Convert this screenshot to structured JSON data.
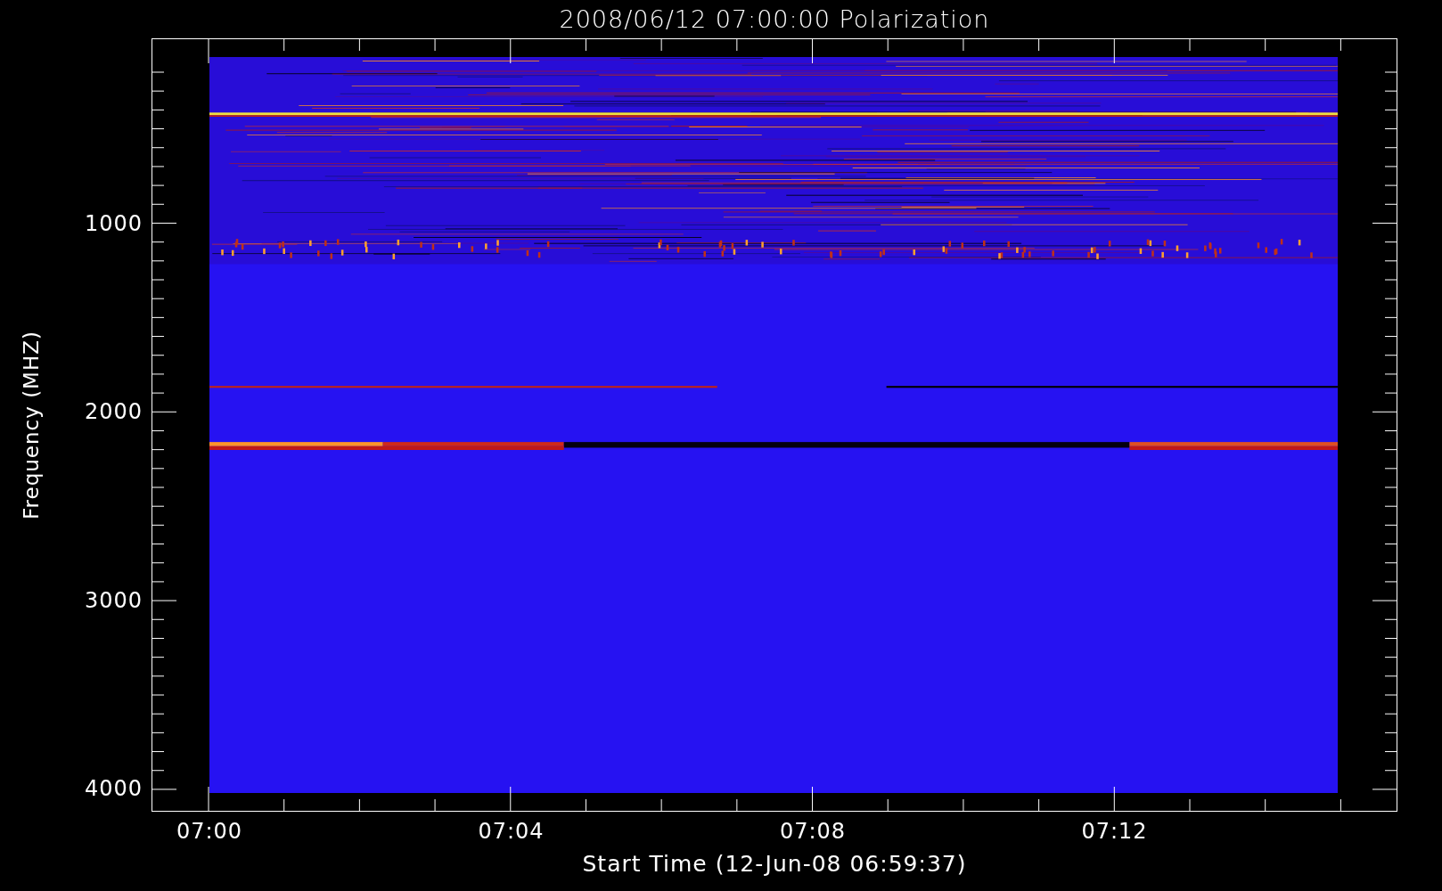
{
  "plot": {
    "title": "2008/06/12 07:00:00 Polarization",
    "xlabel": "Start Time (12-Jun-08 06:59:37)",
    "ylabel": "Frequency (MHZ)",
    "xticks": [
      "07:00",
      "07:04",
      "07:08",
      "07:12"
    ],
    "yticks": [
      "1000",
      "2000",
      "3000",
      "4000"
    ]
  }
}
